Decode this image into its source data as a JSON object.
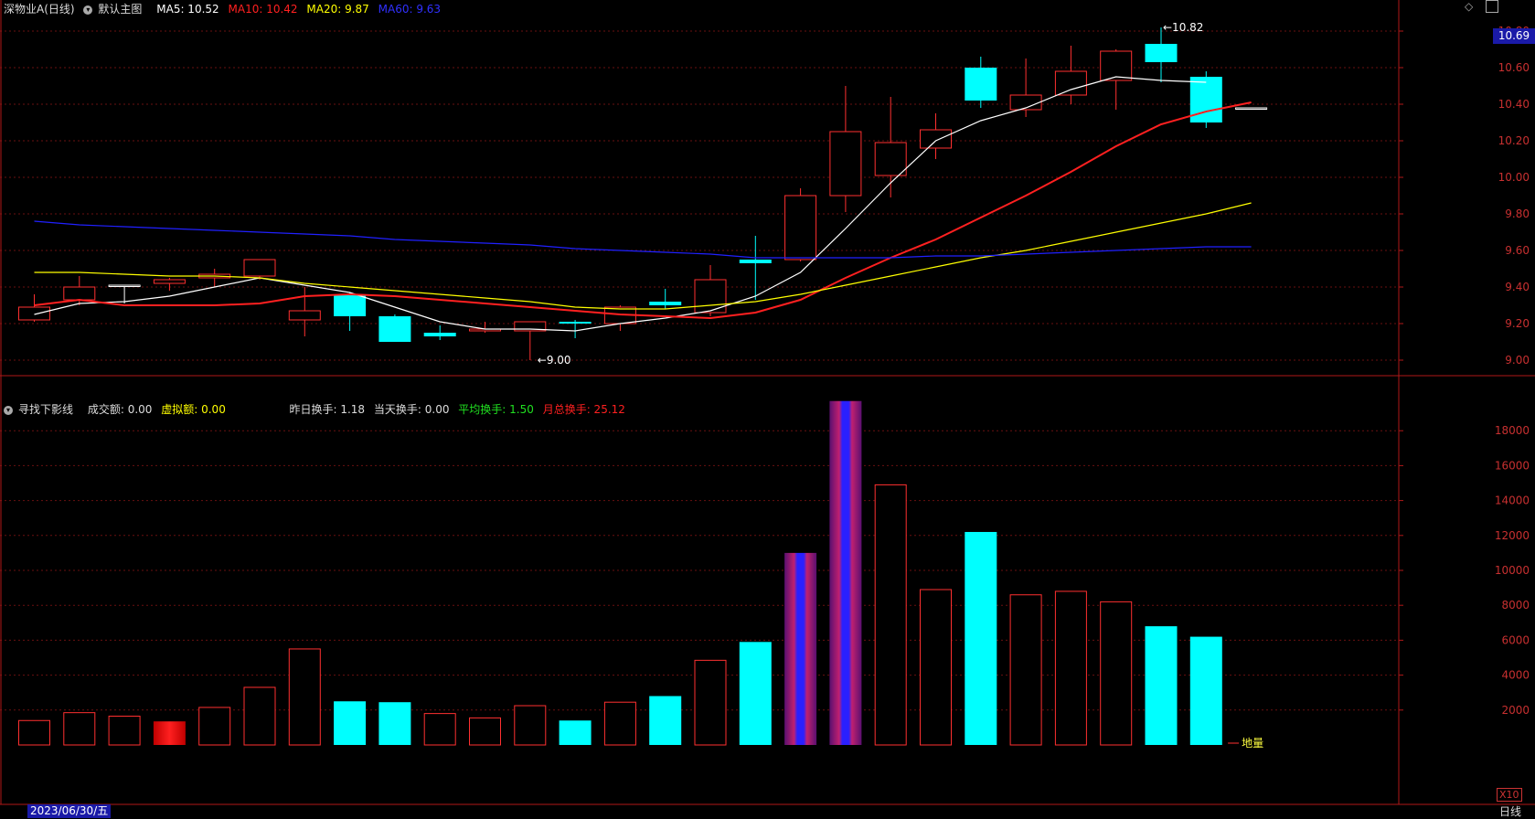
{
  "header": {
    "title": "深物业A(日线)",
    "main_chart_label": "默认主图",
    "ma5": {
      "label": "MA5: 10.52",
      "color": "#ffffff"
    },
    "ma10": {
      "label": "MA10: 10.42",
      "color": "#ff2020"
    },
    "ma20": {
      "label": "MA20: 9.87",
      "color": "#ffff00"
    },
    "ma60": {
      "label": "MA60: 9.63",
      "color": "#2020ff"
    }
  },
  "subheader": {
    "indicator": "寻找下影线",
    "turnover": "成交额: 0.00",
    "virtual": "虚拟额: 0.00",
    "prev_turnover_rate": "昨日换手: 1.18",
    "today_turnover_rate": "当天换手: 0.00",
    "avg_turnover_rate": "平均换手: 1.50",
    "month_turnover_rate": "月总换手: 25.12"
  },
  "current_price": "10.69",
  "cursor_date": "2023/06/30/五",
  "period": "日线",
  "volume_multiplier": "X10",
  "volume_label": "地量",
  "chart_data": [
    {
      "type": "candlestick",
      "price_axis": {
        "ylim": [
          8.92,
          10.88
        ],
        "ticks": [
          "9.00",
          "9.20",
          "9.40",
          "9.60",
          "9.80",
          "10.00",
          "10.20",
          "10.40",
          "10.60",
          "10.80"
        ]
      },
      "candles": [
        {
          "o": 9.22,
          "h": 9.36,
          "l": 9.21,
          "c": 9.29
        },
        {
          "o": 9.33,
          "h": 9.46,
          "l": 9.3,
          "c": 9.4
        },
        {
          "o": 9.41,
          "h": 9.41,
          "l": 9.31,
          "c": 9.41
        },
        {
          "o": 9.42,
          "h": 9.45,
          "l": 9.38,
          "c": 9.44
        },
        {
          "o": 9.45,
          "h": 9.5,
          "l": 9.4,
          "c": 9.47
        },
        {
          "o": 9.46,
          "h": 9.55,
          "l": 9.44,
          "c": 9.55
        },
        {
          "o": 9.22,
          "h": 9.4,
          "l": 9.13,
          "c": 9.27
        },
        {
          "o": 9.36,
          "h": 9.37,
          "l": 9.16,
          "c": 9.24
        },
        {
          "o": 9.24,
          "h": 9.25,
          "l": 9.1,
          "c": 9.1
        },
        {
          "o": 9.15,
          "h": 9.19,
          "l": 9.11,
          "c": 9.13
        },
        {
          "o": 9.16,
          "h": 9.21,
          "l": 9.15,
          "c": 9.17
        },
        {
          "o": 9.16,
          "h": 9.21,
          "l": 9.0,
          "c": 9.21
        },
        {
          "o": 9.21,
          "h": 9.22,
          "l": 9.12,
          "c": 9.2
        },
        {
          "o": 9.2,
          "h": 9.3,
          "l": 9.16,
          "c": 9.29
        },
        {
          "o": 9.32,
          "h": 9.39,
          "l": 9.28,
          "c": 9.3
        },
        {
          "o": 9.26,
          "h": 9.52,
          "l": 9.24,
          "c": 9.44
        },
        {
          "o": 9.55,
          "h": 9.68,
          "l": 9.33,
          "c": 9.53
        },
        {
          "o": 9.55,
          "h": 9.94,
          "l": 9.54,
          "c": 9.9
        },
        {
          "o": 9.9,
          "h": 10.5,
          "l": 9.81,
          "c": 10.25
        },
        {
          "o": 10.01,
          "h": 10.44,
          "l": 9.89,
          "c": 10.19
        },
        {
          "o": 10.16,
          "h": 10.35,
          "l": 10.1,
          "c": 10.26
        },
        {
          "o": 10.6,
          "h": 10.66,
          "l": 10.38,
          "c": 10.42
        },
        {
          "o": 10.37,
          "h": 10.65,
          "l": 10.33,
          "c": 10.45
        },
        {
          "o": 10.45,
          "h": 10.72,
          "l": 10.4,
          "c": 10.58
        },
        {
          "o": 10.53,
          "h": 10.7,
          "l": 10.37,
          "c": 10.69
        },
        {
          "o": 10.73,
          "h": 10.82,
          "l": 10.52,
          "c": 10.63
        },
        {
          "o": 10.55,
          "h": 10.58,
          "l": 10.27,
          "c": 10.3
        },
        {
          "o": 10.38,
          "h": 10.38,
          "l": 10.38,
          "c": 10.38
        }
      ],
      "ma_series": [
        {
          "name": "MA5",
          "color": "#ffffff",
          "values": [
            9.25,
            9.31,
            9.32,
            9.35,
            9.4,
            9.45,
            9.41,
            9.37,
            9.29,
            9.21,
            9.17,
            9.17,
            9.16,
            9.2,
            9.23,
            9.27,
            9.35,
            9.48,
            9.72,
            9.97,
            10.2,
            10.31,
            10.38,
            10.48,
            10.55,
            10.53,
            10.52,
            null
          ]
        },
        {
          "name": "MA10",
          "color": "#ff2020",
          "values": [
            9.3,
            9.33,
            9.3,
            9.3,
            9.3,
            9.31,
            9.35,
            9.36,
            9.35,
            9.33,
            9.31,
            9.29,
            9.27,
            9.25,
            9.24,
            9.23,
            9.26,
            9.33,
            9.45,
            9.56,
            9.66,
            9.78,
            9.9,
            10.03,
            10.17,
            10.29,
            10.36,
            10.41
          ]
        },
        {
          "name": "MA20",
          "color": "#ffff00",
          "values": [
            9.48,
            9.48,
            9.47,
            9.46,
            9.46,
            9.45,
            9.42,
            9.4,
            9.38,
            9.36,
            9.34,
            9.32,
            9.29,
            9.28,
            9.28,
            9.3,
            9.32,
            9.36,
            9.41,
            9.46,
            9.51,
            9.56,
            9.6,
            9.65,
            9.7,
            9.75,
            9.8,
            9.86
          ]
        },
        {
          "name": "MA60",
          "color": "#2020ff",
          "values": [
            9.76,
            9.74,
            9.73,
            9.72,
            9.71,
            9.7,
            9.69,
            9.68,
            9.66,
            9.65,
            9.64,
            9.63,
            9.61,
            9.6,
            9.59,
            9.58,
            9.56,
            9.56,
            9.56,
            9.56,
            9.57,
            9.57,
            9.58,
            9.59,
            9.6,
            9.61,
            9.62,
            9.62
          ]
        }
      ],
      "annotations": [
        {
          "text": "10.82",
          "index": 25,
          "value": 10.82
        },
        {
          "text": "9.00",
          "index": 11,
          "value": 9.0
        }
      ]
    },
    {
      "type": "bar",
      "title": "volume",
      "ylim": [
        0,
        20000
      ],
      "ticks": [
        "2000",
        "4000",
        "6000",
        "8000",
        "10000",
        "12000",
        "14000",
        "16000",
        "18000"
      ],
      "values": [
        1400,
        1850,
        1650,
        1350,
        2150,
        3300,
        5500,
        2500,
        2450,
        1800,
        1550,
        2250,
        1400,
        2450,
        2800,
        4850,
        5900,
        11000,
        19700,
        14900,
        8900,
        12200,
        8600,
        8800,
        8200,
        6800,
        6200
      ],
      "styles": [
        "hollow",
        "hollow",
        "hollow",
        "red",
        "hollow",
        "hollow",
        "hollow",
        "cyan",
        "cyan",
        "hollow",
        "hollow",
        "hollow",
        "cyan",
        "hollow",
        "cyan",
        "hollow",
        "cyan",
        "special",
        "special",
        "hollow",
        "hollow",
        "cyan",
        "hollow",
        "hollow",
        "hollow",
        "cyan",
        "cyan"
      ]
    }
  ]
}
